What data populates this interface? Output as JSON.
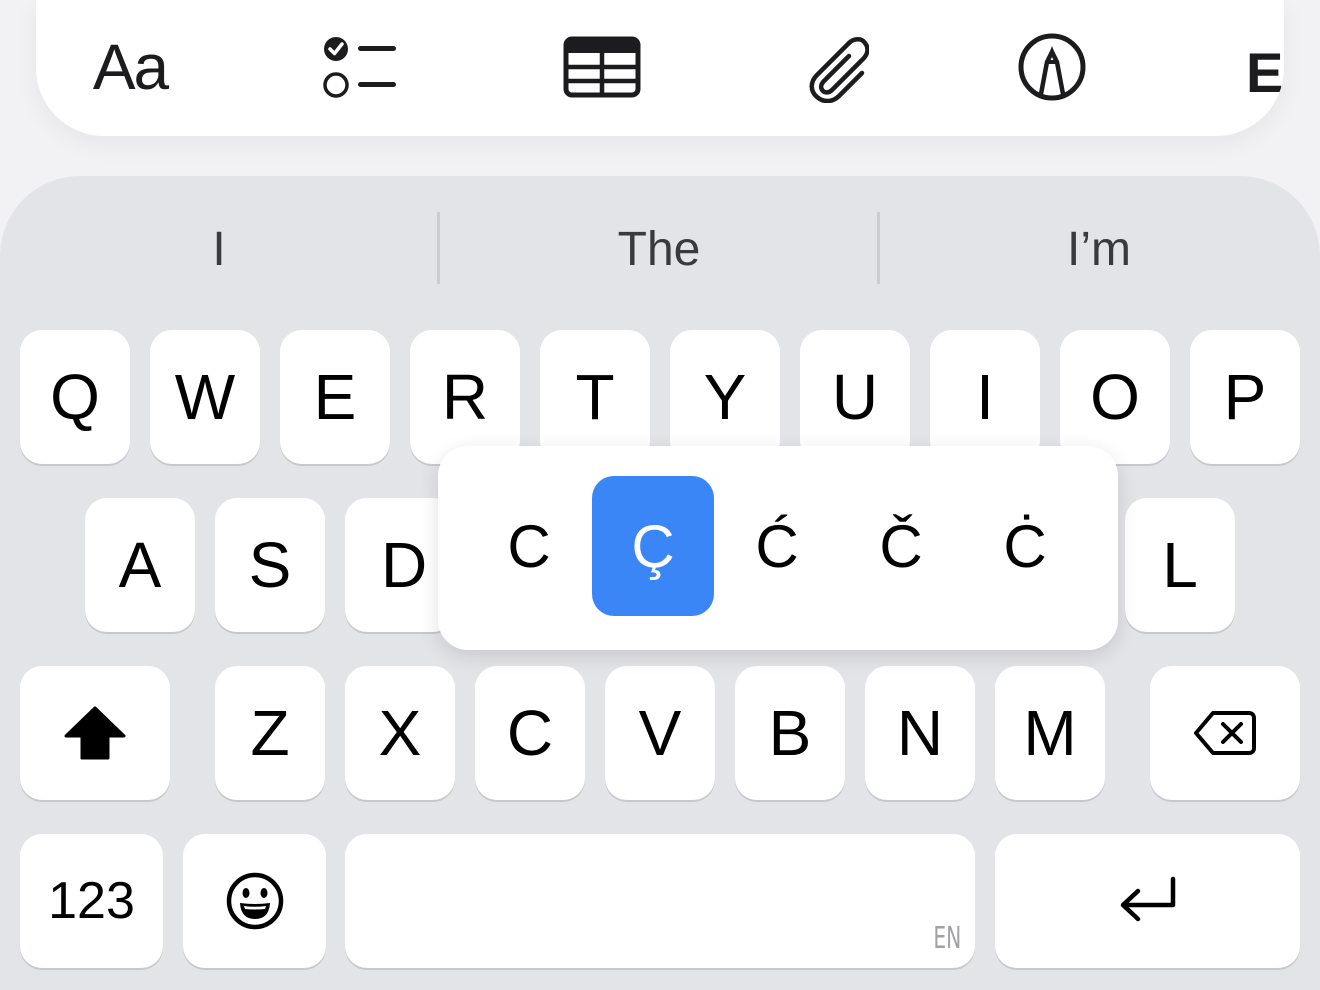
{
  "toolbar": {
    "format_label": "Aa",
    "partial_label": "E"
  },
  "suggestions": [
    "I",
    "The",
    "I’m"
  ],
  "rows": {
    "row1": [
      "Q",
      "W",
      "E",
      "R",
      "T",
      "Y",
      "U",
      "I",
      "O",
      "P"
    ],
    "row2": [
      "A",
      "S",
      "D",
      "L"
    ],
    "row3": [
      "Z",
      "X",
      "C",
      "V",
      "B",
      "N",
      "M"
    ]
  },
  "bottom": {
    "numbers_label": "123",
    "language": "EN"
  },
  "accent_popup": {
    "options": [
      "C",
      "Ç",
      "Ć",
      "Č",
      "Ċ"
    ],
    "selected_index": 1
  },
  "icons": {
    "toolbar": [
      "checklist-icon",
      "table-icon",
      "paperclip-icon",
      "markup-pen-icon"
    ],
    "keys": [
      "shift-icon",
      "delete-icon",
      "emoji-icon",
      "return-icon"
    ]
  },
  "colors": {
    "selected_accent": "#3b86f7",
    "keyboard_bg": "#e3e4e8",
    "key_bg": "#ffffff"
  }
}
